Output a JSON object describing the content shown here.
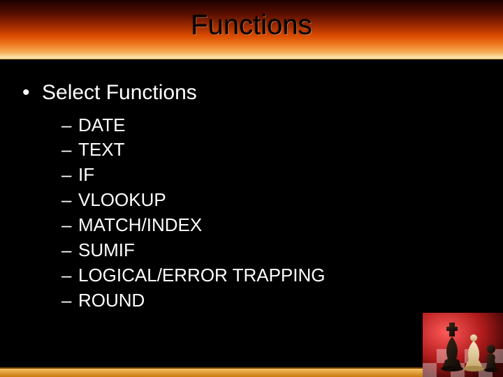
{
  "title": "Functions",
  "body": {
    "heading": "Select Functions",
    "items": [
      "DATE",
      "TEXT",
      "IF",
      "VLOOKUP",
      "MATCH/INDEX",
      "SUMIF",
      "LOGICAL/ERROR TRAPPING",
      "ROUND"
    ]
  },
  "glyphs": {
    "bullet": "•",
    "dash": "–"
  }
}
